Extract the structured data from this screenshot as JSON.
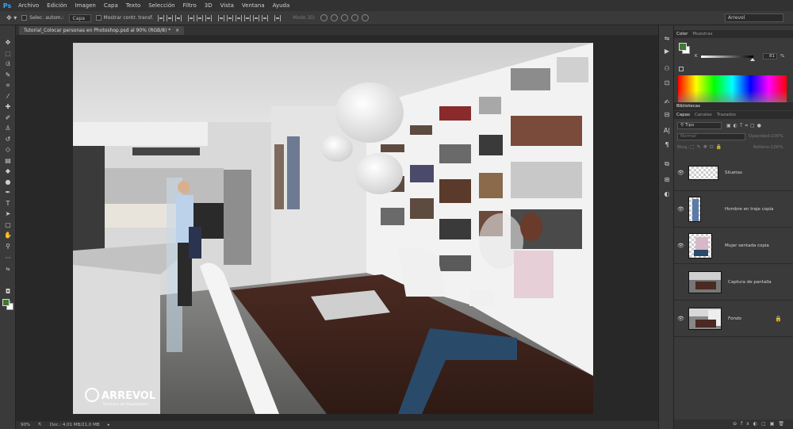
{
  "app": {
    "logo": "Ps",
    "menu": [
      "Archivo",
      "Edición",
      "Imagen",
      "Capa",
      "Texto",
      "Selección",
      "Filtro",
      "3D",
      "Vista",
      "Ventana",
      "Ayuda"
    ]
  },
  "options": {
    "auto_select_label": "Selec. autom.:",
    "auto_select_value": "Capa",
    "transform_label": "Mostrar contr. transf.",
    "mode3d_label": "Modo 3D:",
    "workspace": "Arrevol"
  },
  "document": {
    "tab_title": "Tutorial_Colocar personas en Photoshop.psd al 90% (RGB/8) *",
    "close_glyph": "×"
  },
  "canvas": {
    "watermark_title": "ARREVOL",
    "watermark_subtitle": "Servicios de Arquitectura"
  },
  "status": {
    "zoom": "90%",
    "doc_info": "Doc.: 4,01 MB/21,0 MB"
  },
  "color_panel": {
    "tabs": [
      "Color",
      "Muestras"
    ],
    "fg_color": "#3f7a2e",
    "bg_color": "#ffffff",
    "channel_label": "K",
    "channel_value": "81",
    "percent": "%"
  },
  "libraries_panel": {
    "tab": "Bibliotecas"
  },
  "layers_panel": {
    "tabs": [
      "Capas",
      "Canales",
      "Trazados"
    ],
    "filter_value": "Tipo",
    "blend_mode": "Normal",
    "opacity_label": "Opacidad:",
    "opacity_value": "100%",
    "lock_label": "Bloq.:",
    "fill_label": "Relleno:",
    "fill_value": "100%",
    "layers": [
      {
        "name": "Siluetas",
        "visible": true
      },
      {
        "name": "Hombre en traje copia",
        "visible": true
      },
      {
        "name": "Mujer sentada copia",
        "visible": true
      },
      {
        "name": "Captura de pantalla",
        "visible": false
      },
      {
        "name": "Fondo",
        "visible": true,
        "locked": true
      }
    ]
  }
}
